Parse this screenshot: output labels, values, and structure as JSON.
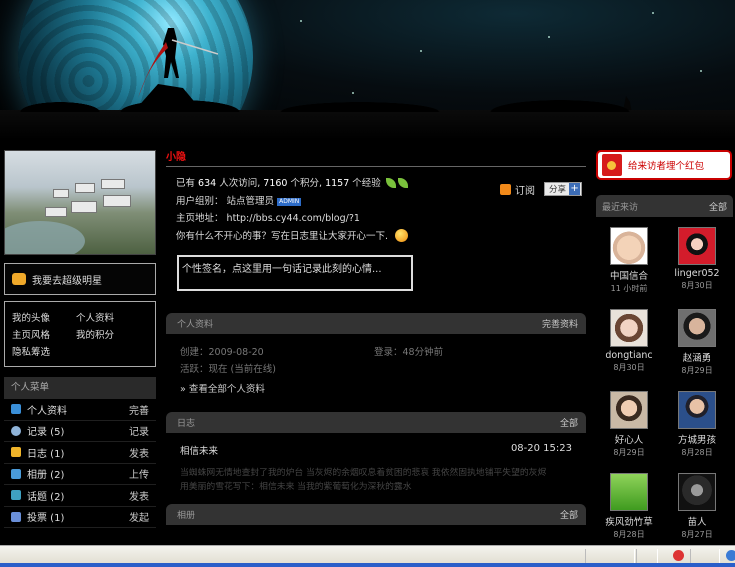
{
  "profile": {
    "username": "小隐",
    "stats_prefix": "已有",
    "visits": "634",
    "visits_label": "人次访问,",
    "points": "7160",
    "points_label": "个积分,",
    "exp": "1157",
    "exp_label": "个经验",
    "group_label": "用户组别：",
    "group_value": "站点管理员",
    "admin_badge": "ADMIN",
    "homepage_label": "主页地址：",
    "homepage_url": "http://bbs.cy44.com/blog/?1",
    "mood_prompt": "你有什么不开心的事？写在日志里让大家开心一下.",
    "subscribe_label": "订阅",
    "share_label": "分享",
    "share_plus": "+",
    "signature_placeholder": "个性签名，点这里用一句话记录此刻的心情..."
  },
  "left": {
    "hot_star_label": "我要去超级明星",
    "quicklinks": [
      "我的头像",
      "个人资料",
      "主页风格",
      "我的积分",
      "隐私筹选"
    ],
    "menu_title": "个人菜单",
    "menu": [
      {
        "label": "个人资料",
        "action": "完善",
        "color": "#3a8fd8"
      },
      {
        "label": "记录 (5)",
        "action": "记录",
        "color": "#8fb3d8"
      },
      {
        "label": "日志 (1)",
        "action": "发表",
        "color": "#f0b42a"
      },
      {
        "label": "相册 (2)",
        "action": "上传",
        "color": "#4a9ad8"
      },
      {
        "label": "话题 (2)",
        "action": "发表",
        "color": "#3fa0c0"
      },
      {
        "label": "投票 (1)",
        "action": "发起",
        "color": "#6a8fd8"
      }
    ]
  },
  "panels": {
    "profile_title": "个人资料",
    "profile_more": "完善资料",
    "created": "创建：2009-08-20",
    "login": "登录：48分钟前",
    "active": "活跃：现在 (当前在线)",
    "view_all": "» 查看全部个人资料",
    "blog_title": "日志",
    "blog_more": "全部",
    "blog_entry_title": "相信未来",
    "blog_entry_date": "08-20 15:23",
    "blog_excerpt_1": "当蜘蛛网无情地查封了我的炉台 当灰烬的余烟叹息着贫困的悲哀 我依然固执地铺平失望的灰烬",
    "blog_excerpt_2": "用美丽的雪花写下：相信未来 当我的紫葡萄化为深秋的露水",
    "album_title": "相册",
    "album_more": "全部"
  },
  "right": {
    "red_packet_label": "给来访者埋个红包",
    "visitors_title": "最近来访",
    "visitors_more": "全部",
    "visitors": [
      {
        "name": "中国信合",
        "time": "11 小时前",
        "avatar": "baby-face"
      },
      {
        "name": "linger052",
        "time": "8月30日",
        "avatar": "red-girl"
      },
      {
        "name": "dongtianc",
        "time": "8月30日",
        "avatar": "woman-face"
      },
      {
        "name": "赵涵勇",
        "time": "8月29日",
        "avatar": "man-glasses"
      },
      {
        "name": "好心人",
        "time": "8月29日",
        "avatar": "young-man"
      },
      {
        "name": "方城男孩",
        "time": "8月28日",
        "avatar": "man-suit"
      },
      {
        "name": "疾风劲竹草",
        "time": "8月28日",
        "avatar": "green-grass"
      },
      {
        "name": "苗人",
        "time": "8月27日",
        "avatar": "dark-face"
      }
    ]
  }
}
